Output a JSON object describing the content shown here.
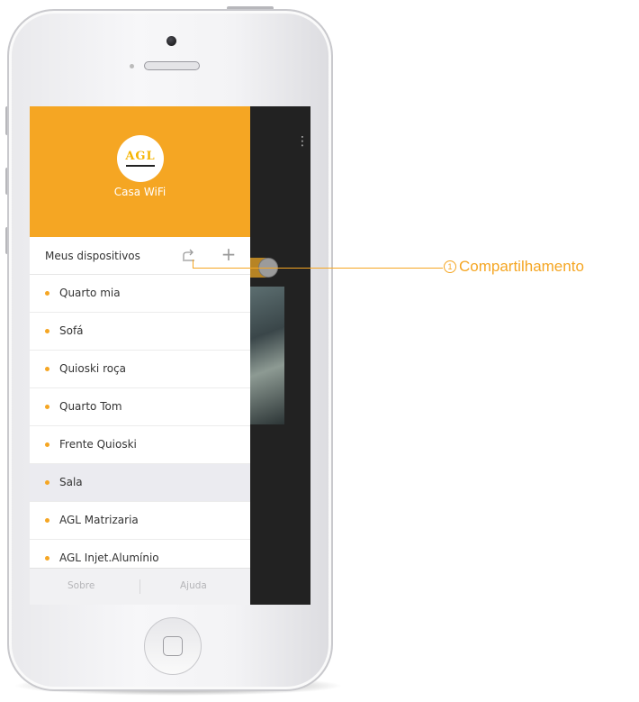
{
  "app": {
    "home_name": "Casa WiFi",
    "logo_text": "AGL",
    "accent_color": "#f5a623"
  },
  "devices": {
    "title": "Meus dispositivos",
    "share_icon": "share-icon",
    "add_icon": "add-icon",
    "items": [
      {
        "label": "Quarto mia",
        "selected": false
      },
      {
        "label": "Sofá",
        "selected": false
      },
      {
        "label": "Quioski roça",
        "selected": false
      },
      {
        "label": "Quarto Tom",
        "selected": false
      },
      {
        "label": "Frente Quioski",
        "selected": false
      },
      {
        "label": "Sala",
        "selected": true
      },
      {
        "label": "AGL Matrizaria",
        "selected": false
      },
      {
        "label": "AGL Injet.Alumínio",
        "selected": false
      }
    ]
  },
  "footer": {
    "about_label": "Sobre",
    "help_label": "Ajuda"
  },
  "callout": {
    "number": "1",
    "label": "Compartilhamento"
  }
}
